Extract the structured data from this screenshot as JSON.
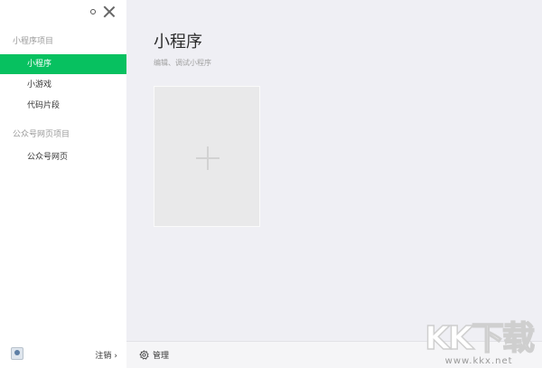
{
  "sidebar": {
    "sections": [
      {
        "title": "小程序项目",
        "items": [
          "小程序",
          "小游戏",
          "代码片段"
        ]
      },
      {
        "title": "公众号网页项目",
        "items": [
          "公众号网页"
        ]
      }
    ],
    "footer": {
      "logout_label": "注销"
    }
  },
  "main": {
    "title": "小程序",
    "subtitle": "编辑、调试小程序"
  },
  "bottom_bar": {
    "manage_label": "管理"
  },
  "watermark": {
    "logo_text": "KK下载",
    "url": "www.kkx.net"
  },
  "colors": {
    "accent": "#07c160",
    "sidebar_bg": "#ffffff",
    "main_bg": "#efeff4"
  }
}
